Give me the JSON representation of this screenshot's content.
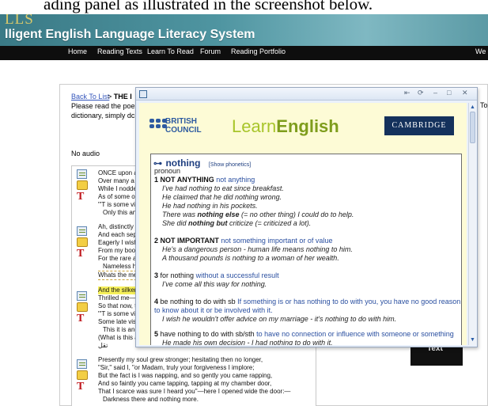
{
  "page_top_text": "ading panel as illustrated in the screenshot below.",
  "site": {
    "logo": "LLS",
    "subtitle": "lligent English Language Literacy System"
  },
  "nav": [
    "Home",
    "Reading Texts",
    "Learn To Read",
    "Forum",
    "Reading Portfolio",
    "We"
  ],
  "main": {
    "back_link": "Back To List",
    "breadcrumb_sep": ">",
    "breadcrumb_title": "THE I",
    "instruction_1": "Please read the poe",
    "instruction_2": "dictionary, simply dc",
    "right_text": "To",
    "no_audio": "No audio"
  },
  "poem": [
    {
      "lines": [
        "ONCE upon a",
        "Over many a c",
        "While I nodde",
        "As of some or",
        "\"'T is some vis",
        "Only this an"
      ]
    },
    {
      "lines": [
        "Ah, distinctly I",
        "And each sepa",
        "Eagerly I wishe",
        "From my book",
        "For the rare an",
        "Nameless h",
        "Whats the me"
      ]
    },
    {
      "lines": [
        "And the silken",
        "Thrilled me—t",
        "So that now, t",
        "\"'T is some vis",
        "Some late visit",
        "This it is and",
        "(What is this a",
        "تقل"
      ]
    },
    {
      "lines": [
        "Presently my soul grew stronger; hesitating then no longer,",
        "\"Sir,\" said I, \"or Madam, truly your forgiveness I implore;",
        "But the fact is I was napping, and so gently you came rapping,",
        "And so faintly you came tapping, tapping at my chamber door,",
        "That I scarce was sure I heard you\"—here I opened wide the door:—",
        "Darkness there and nothing more."
      ]
    }
  ],
  "side_button": "Text",
  "popup": {
    "window_buttons": [
      "⇤",
      "⟳",
      "–",
      "□",
      "✕"
    ],
    "british_council": [
      "BRITISH",
      "COUNCIL"
    ],
    "learn": "Learn",
    "english": "English",
    "cambridge": "CAMBRIDGE",
    "key_icon": "⊶",
    "headword": "nothing",
    "show_phonetics": "[Show phonetics]",
    "part_of_speech": "pronoun",
    "senses": [
      {
        "num": "1",
        "label": "NOT ANYTHING",
        "def": "not anything",
        "examples": [
          "I've had nothing to eat since breakfast.",
          "He claimed that he did nothing wrong.",
          "He had nothing in his pockets."
        ],
        "ex4": {
          "a": "There was ",
          "b": "nothing else",
          "c": " (= no other thing) I could do to help."
        },
        "ex5": {
          "a": "She did ",
          "b": "nothing but",
          "c": " criticize (= criticized a lot)."
        }
      },
      {
        "num": "2",
        "label": "NOT IMPORTANT",
        "def": "not something important or of value",
        "examples": [
          "He's a dangerous person - human life means nothing to him.",
          "A thousand pounds is nothing to a woman of her wealth."
        ]
      },
      {
        "num": "3",
        "label": "for nothing",
        "def": "without a successful result",
        "examples": [
          "I've come all this way for nothing."
        ]
      },
      {
        "num": "4",
        "label": "be nothing to do with sb",
        "def": "If something is or has nothing to do with you, you have no good reason to know about it or be involved with it.",
        "examples": [
          "I wish he wouldn't offer advice on my marriage - it's nothing to do with him."
        ]
      },
      {
        "num": "5",
        "label": "have nothing to do with sb/sth",
        "def": "to have no connection or influence with someone or something",
        "examples": [
          "He made his own decision - I had nothing to do with it."
        ]
      }
    ]
  }
}
